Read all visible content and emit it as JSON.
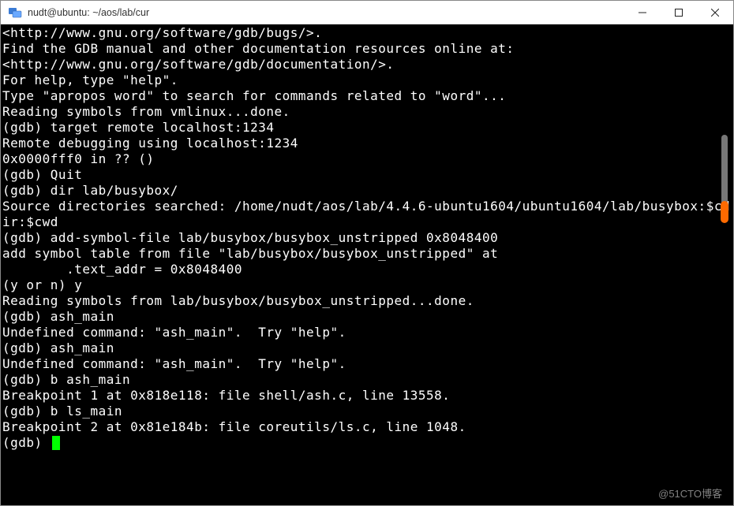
{
  "window": {
    "title": "nudt@ubuntu: ~/aos/lab/cur"
  },
  "terminal": {
    "lines": [
      "<http://www.gnu.org/software/gdb/bugs/>.",
      "Find the GDB manual and other documentation resources online at:",
      "<http://www.gnu.org/software/gdb/documentation/>.",
      "For help, type \"help\".",
      "Type \"apropos word\" to search for commands related to \"word\"...",
      "Reading symbols from vmlinux...done.",
      "(gdb) target remote localhost:1234",
      "Remote debugging using localhost:1234",
      "0x0000fff0 in ?? ()",
      "(gdb) Quit",
      "(gdb) dir lab/busybox/",
      "Source directories searched: /home/nudt/aos/lab/4.4.6-ubuntu1604/ubuntu1604/lab/busybox:$cdir:$cwd",
      "(gdb) add-symbol-file lab/busybox/busybox_unstripped 0x8048400",
      "add symbol table from file \"lab/busybox/busybox_unstripped\" at",
      "        .text_addr = 0x8048400",
      "(y or n) y",
      "Reading symbols from lab/busybox/busybox_unstripped...done.",
      "(gdb) ash_main",
      "Undefined command: \"ash_main\".  Try \"help\".",
      "(gdb) ash_main",
      "Undefined command: \"ash_main\".  Try \"help\".",
      "(gdb) b ash_main",
      "Breakpoint 1 at 0x818e118: file shell/ash.c, line 13558.",
      "(gdb) b ls_main",
      "Breakpoint 2 at 0x81e184b: file coreutils/ls.c, line 1048.",
      "(gdb) "
    ]
  },
  "watermark": "@51CTO博客"
}
